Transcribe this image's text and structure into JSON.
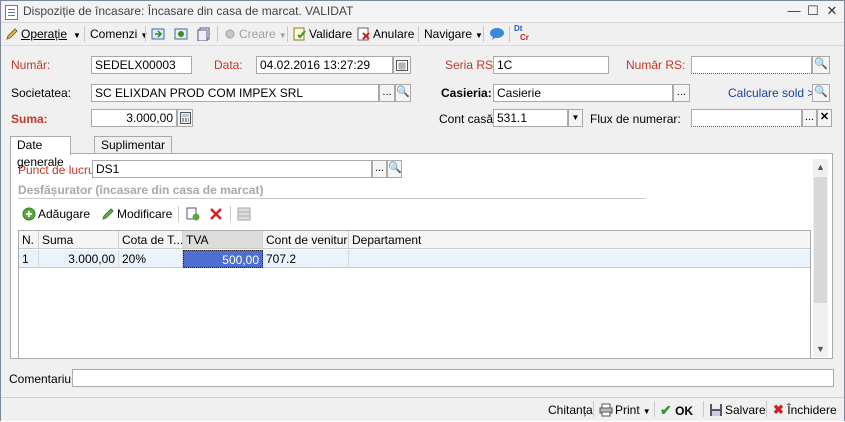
{
  "window": {
    "title": "Dispoziție de încasare: Încasare din casa de marcat. VALIDAT",
    "controls": [
      "minimize-icon",
      "restore-icon",
      "close-icon"
    ]
  },
  "toolbar": {
    "operatie": "Operație",
    "comenzi": "Comenzi",
    "creare": "Creare",
    "validare": "Validare",
    "anulare": "Anulare",
    "navigare": "Navigare",
    "dr": "Dt",
    "cr": "Cr"
  },
  "form": {
    "numar_label": "Număr:",
    "numar_value": "SEDELX00003",
    "data_label": "Data:",
    "data_value": "04.02.2016 13:27:29",
    "seria_label": "Seria RS:",
    "seria_value": "1C",
    "numar_rs_label": "Număr RS:",
    "numar_rs_value": "",
    "societatea_label": "Societatea:",
    "societatea_value": "SC ELIXDAN PROD COM IMPEX SRL",
    "casieria_label": "Casieria:",
    "casieria_value": "Casierie",
    "calculare_link": "Calculare sold >>",
    "suma_label": "Suma:",
    "suma_value": "3.000,00",
    "cont_casa_label": "Cont casă:",
    "cont_casa_value": "531.1",
    "flux_label": "Flux de numerar:",
    "flux_value": "",
    "ellipsis": "..."
  },
  "tabs": [
    "Date generale",
    "Suplimentar"
  ],
  "general": {
    "punct_label": "Punct de lucru:",
    "punct_value": "DS1",
    "section_title": "Desfășurator (încasare din casa de marcat)",
    "adaugare": "Adăugare",
    "modificare": "Modificare"
  },
  "grid": {
    "columns": [
      "N.",
      "Suma",
      "Cota de T...",
      "TVA",
      "Cont de venituri",
      "Departament"
    ],
    "rows": [
      {
        "n": "1",
        "suma": "3.000,00",
        "cota": "20%",
        "tva": "500,00",
        "cont": "707.2",
        "departament": ""
      }
    ]
  },
  "comentariu_label": "Comentariu:",
  "comentariu_value": "",
  "statusbar": {
    "chitanta": "Chitanța",
    "print": "Print",
    "ok": "OK",
    "salvare": "Salvare",
    "inchidere": "Închidere"
  },
  "colors": {
    "required_label": "#c0392b",
    "link": "#1a3fa0",
    "selected_cell": "#4f6fd0",
    "row_bg": "#eaf3fb"
  }
}
